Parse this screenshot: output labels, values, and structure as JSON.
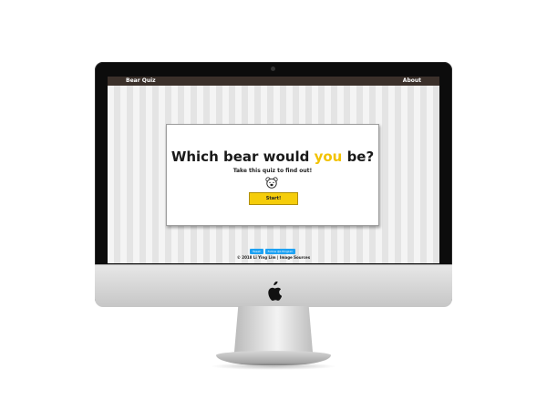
{
  "navbar": {
    "brand": "Bear Quiz",
    "about_link": "About"
  },
  "hero": {
    "title_before": "Which bear would ",
    "title_accent": "you",
    "title_after": " be?",
    "subtitle": "Take this quiz to find out!",
    "icon": "bear-face-icon",
    "start_label": "Start!"
  },
  "share": {
    "tweet_label": "Tweet",
    "follow_label": "Follow @LiYingLim"
  },
  "footer": {
    "text": "© 2018 Li Ying Lim | Image Sources"
  },
  "colors": {
    "accent": "#f2c200",
    "button": "#f5cd0a",
    "navbar": "#3b302a",
    "twitter": "#1da1f2"
  }
}
